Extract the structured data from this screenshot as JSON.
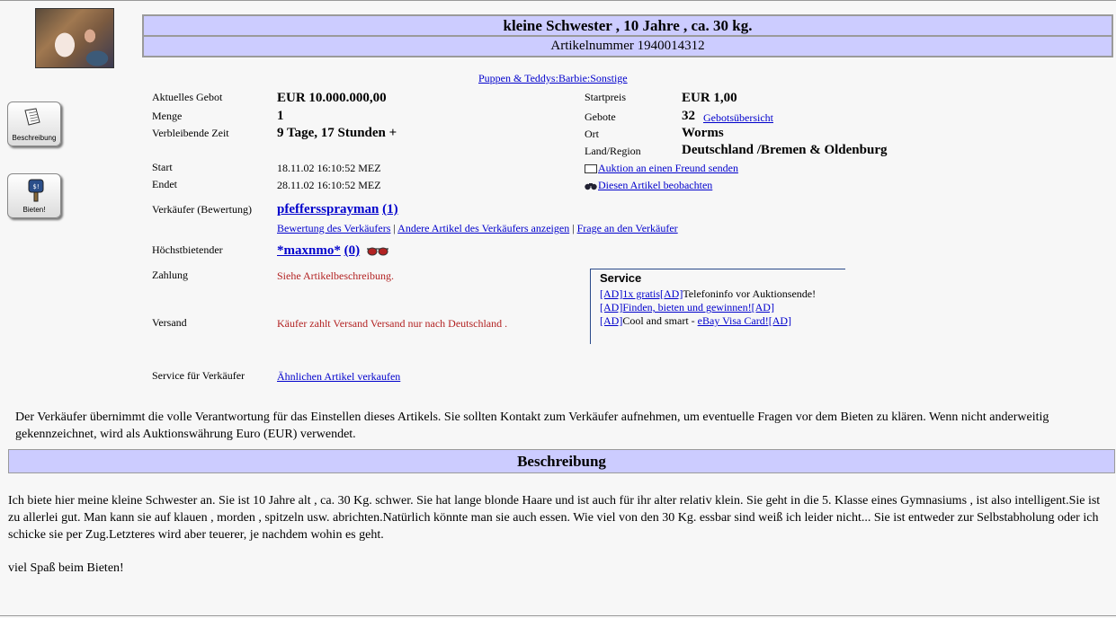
{
  "title": "kleine Schwester , 10 Jahre , ca. 30 kg.",
  "item_number": "Artikelnummer 1940014312",
  "category": "Puppen & Teddys:Barbie:Sonstige",
  "sidebar": {
    "description_label": "Beschreibung",
    "bid_label": "Bieten!"
  },
  "left": {
    "current_bid_label": "Aktuelles Gebot",
    "current_bid": "EUR 10.000.000,00",
    "quantity_label": "Menge",
    "quantity": "1",
    "time_left_label": "Verbleibende Zeit",
    "time_left": "9 Tage, 17 Stunden +",
    "start_label": "Start",
    "start": "18.11.02 16:10:52 MEZ",
    "end_label": "Endet",
    "end": "28.11.02 16:10:52 MEZ",
    "seller_label": "Verkäufer (Bewertung)",
    "seller": "pfefferssprayman",
    "seller_rating": "(1)",
    "seller_links": {
      "ratings": "Bewertung des Verkäufers",
      "sep1": " | ",
      "other_items": "Andere Artikel des Verkäufers anzeigen",
      "sep2": " | ",
      "question": "Frage an den Verkäufer"
    },
    "high_bidder_label": "Höchstbietender",
    "high_bidder": "*maxnmo*",
    "high_bidder_rating": "(0)",
    "payment_label": "Zahlung",
    "payment": "Siehe Artikelbeschreibung.",
    "shipping_label": "Versand",
    "shipping": "Käufer zahlt Versand Versand nur nach Deutschland .",
    "seller_service_label": "Service für Verkäufer",
    "sell_similar": "Ähnlichen Artikel verkaufen"
  },
  "right": {
    "start_price_label": "Startpreis",
    "start_price": "EUR 1,00",
    "bids_label": "Gebote",
    "bids": "32",
    "bid_history": "Gebotsübersicht",
    "location_label": "Ort",
    "location": "Worms",
    "region_label": "Land/Region",
    "region": "Deutschland /Bremen & Oldenburg",
    "send_to_friend": "Auktion an einen Freund senden",
    "watch_item": "Diesen Artikel beobachten"
  },
  "service": {
    "title": "Service",
    "line1_link": "[AD]1x gratis[AD]",
    "line1_text": "Telefoninfo vor Auktionsende!",
    "line2_link": "[AD]Finden, bieten und gewinnen![AD]",
    "line3_ad": "[AD]",
    "line3_text": "Cool and smart - ",
    "line3_link": "eBay Visa Card![AD]"
  },
  "disclaimer": "Der Verkäufer übernimmt die volle Verantwortung für das Einstellen dieses Artikels. Sie sollten Kontakt zum Verkäufer aufnehmen, um eventuelle Fragen vor dem Bieten zu klären. Wenn nicht anderweitig gekennzeichnet, wird als Auktionswährung Euro (EUR) verwendet.",
  "description_heading": "Beschreibung",
  "description": "Ich biete hier meine kleine Schwester an. Sie ist 10 Jahre alt , ca. 30 Kg. schwer. Sie hat lange blonde Haare und ist auch für ihr alter relativ klein. Sie geht in die 5. Klasse eines Gymnasiums , ist also intelligent.Sie ist zu allerlei gut. Man kann sie auf klauen , morden , spitzeln usw. abrichten.Natürlich könnte man sie auch essen. Wie viel von den 30 Kg. essbar sind weiß ich leider nicht... Sie ist entweder zur Selbstabholung oder ich schicke sie per Zug.Letzteres wird aber teuerer, je nachdem wohin es geht.",
  "description_closing": "viel Spaß beim Bieten!"
}
